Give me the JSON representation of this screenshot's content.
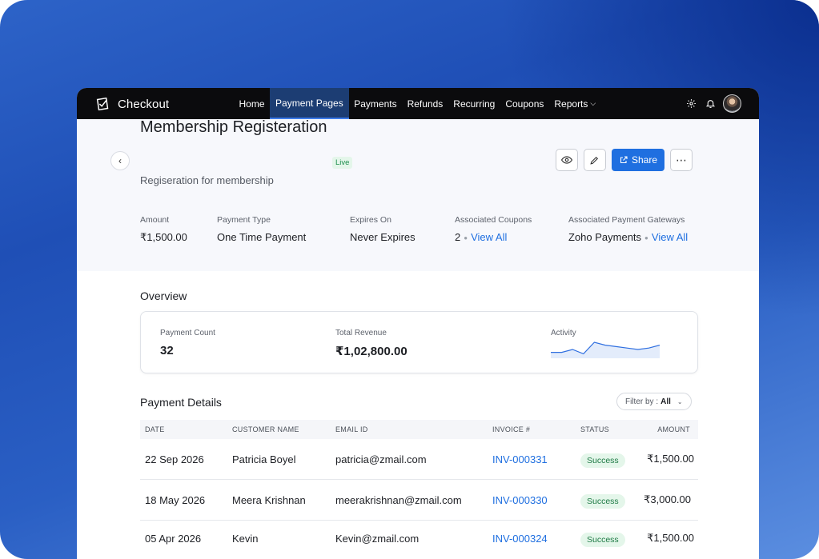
{
  "app": {
    "name": "Checkout"
  },
  "nav": {
    "items": [
      {
        "label": "Home"
      },
      {
        "label": "Payment Pages",
        "active": true
      },
      {
        "label": "Payments"
      },
      {
        "label": "Refunds"
      },
      {
        "label": "Recurring"
      },
      {
        "label": "Coupons"
      },
      {
        "label": "Reports",
        "has_dropdown": true
      }
    ]
  },
  "page": {
    "title": "Membership Registeration",
    "status": "Live",
    "subtitle": "Regiseration for membership",
    "share_label": "Share"
  },
  "meta": {
    "amount_label": "Amount",
    "amount_value": "₹1,500.00",
    "payment_type_label": "Payment Type",
    "payment_type_value": "One Time Payment",
    "expires_label": "Expires On",
    "expires_value": "Never Expires",
    "coupons_label": "Associated Coupons",
    "coupons_count": "2",
    "coupons_link": "View All",
    "gateways_label": "Associated Payment Gateways",
    "gateways_value": "Zoho Payments",
    "gateways_link": "View All"
  },
  "overview": {
    "title": "Overview",
    "payment_count_label": "Payment Count",
    "payment_count_value": "32",
    "total_revenue_label": "Total Revenue",
    "total_revenue_value": "₹1,02,800.00",
    "activity_label": "Activity",
    "activity_trend": [
      3,
      3,
      5,
      2,
      10,
      8,
      7,
      6,
      5,
      6,
      8
    ]
  },
  "payment_details": {
    "title": "Payment Details",
    "filter_label": "Filter by :",
    "filter_value": "All",
    "columns": [
      "DATE",
      "CUSTOMER NAME",
      "EMAIL ID",
      "INVOICE #",
      "STATUS",
      "AMOUNT"
    ],
    "rows": [
      {
        "date": "22 Sep 2026",
        "name": "Patricia Boyel",
        "email": "patricia@zmail.com",
        "invoice": "INV-000331",
        "status": "Success",
        "amount": "₹1,500.00"
      },
      {
        "date": "18 May 2026",
        "name": "Meera Krishnan",
        "email": "meerakrishnan@zmail.com",
        "invoice": "INV-000330",
        "status": "Success",
        "amount": "₹3,000.00"
      },
      {
        "date": "05 Apr 2026",
        "name": "Kevin",
        "email": "Kevin@zmail.com",
        "invoice": "INV-000324",
        "status": "Success",
        "amount": "₹1,500.00"
      }
    ]
  },
  "colors": {
    "accent": "#1f6fe0",
    "success": "#1e7a45",
    "topbar": "#0b0b0d"
  }
}
